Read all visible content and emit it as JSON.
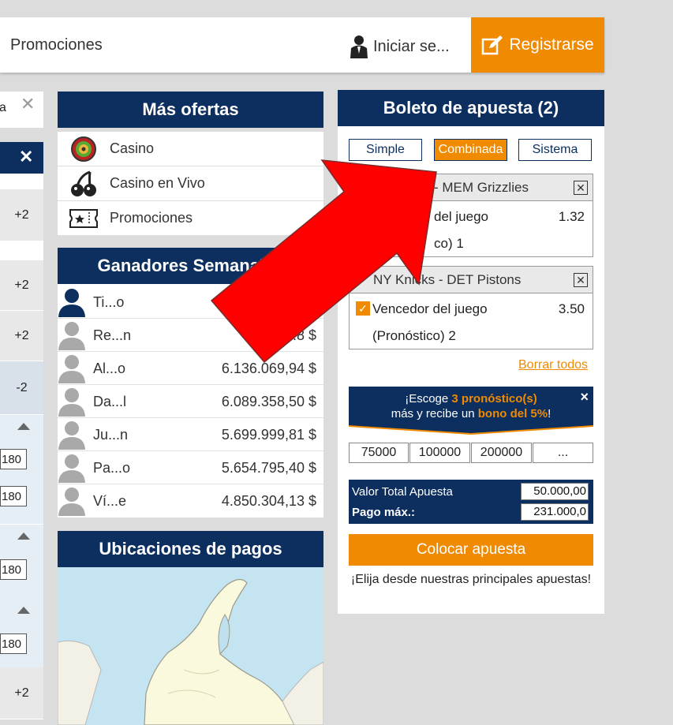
{
  "topbar": {
    "promo_label": "Promociones",
    "login_label": "Iniciar se...",
    "register_label": "Registrarse"
  },
  "left_col": {
    "header_fragment": "a",
    "close_x": "✕",
    "buttons": [
      "+2",
      "+2",
      "+2",
      "-2",
      "+2"
    ],
    "odds": [
      "180",
      "180",
      "180",
      "180"
    ]
  },
  "offers": {
    "title": "Más ofertas",
    "items": [
      {
        "label": "Casino",
        "icon": "roulette-icon"
      },
      {
        "label": "Casino en Vivo",
        "icon": "cherries-icon"
      },
      {
        "label": "Promociones",
        "icon": "ticket-icon"
      }
    ]
  },
  "winners": {
    "title": "Ganadores Semanales",
    "rows": [
      {
        "name": "Ti...o",
        "amount": ""
      },
      {
        "name": "Re...n",
        "amount": "6.12...8 $"
      },
      {
        "name": "Al...o",
        "amount": "6.136.069,94 $"
      },
      {
        "name": "Da...l",
        "amount": "6.089.358,50 $"
      },
      {
        "name": "Ju...n",
        "amount": "5.699.999,81 $"
      },
      {
        "name": "Pa...o",
        "amount": "5.654.795,40 $"
      },
      {
        "name": "Ví...e",
        "amount": "4.850.304,13 $"
      }
    ]
  },
  "payments": {
    "title": "Ubicaciones de pagos"
  },
  "slip": {
    "title": "Boleto de apuesta (2)",
    "bet_types": [
      "Simple",
      "Combinada",
      "Sistema"
    ],
    "selected_type": "Combinada",
    "bets": [
      {
        "match": "- MEM Grizzlies",
        "market": "del juego",
        "odd": "1.32",
        "pick": "co) 1"
      },
      {
        "match": "NY Knicks - DET Pistons",
        "market": "Vencedor del juego",
        "odd": "3.50",
        "pick": "(Pronóstico) 2"
      }
    ],
    "clear_all": "Borrar todos",
    "bonus": {
      "line1_pre": "¡Escoge ",
      "line1_hl": "3 pronóstico(s)",
      "line2_pre": "más y recibe un ",
      "line2_hl": "bono del 5%",
      "line2_post": "!",
      "close": "×"
    },
    "quick_amounts": [
      "75000",
      "100000",
      "200000",
      "..."
    ],
    "total_label": "Valor Total Apuesta",
    "total_value": "50.000,00",
    "max_label": "Pago máx.:",
    "max_value": "231.000,0",
    "place_bet": "Colocar apuesta",
    "footer": "¡Elija desde nuestras principales apuestas!"
  },
  "colors": {
    "navy": "#0c2f5f",
    "orange": "#f08a00",
    "arrow": "#ff0000"
  }
}
